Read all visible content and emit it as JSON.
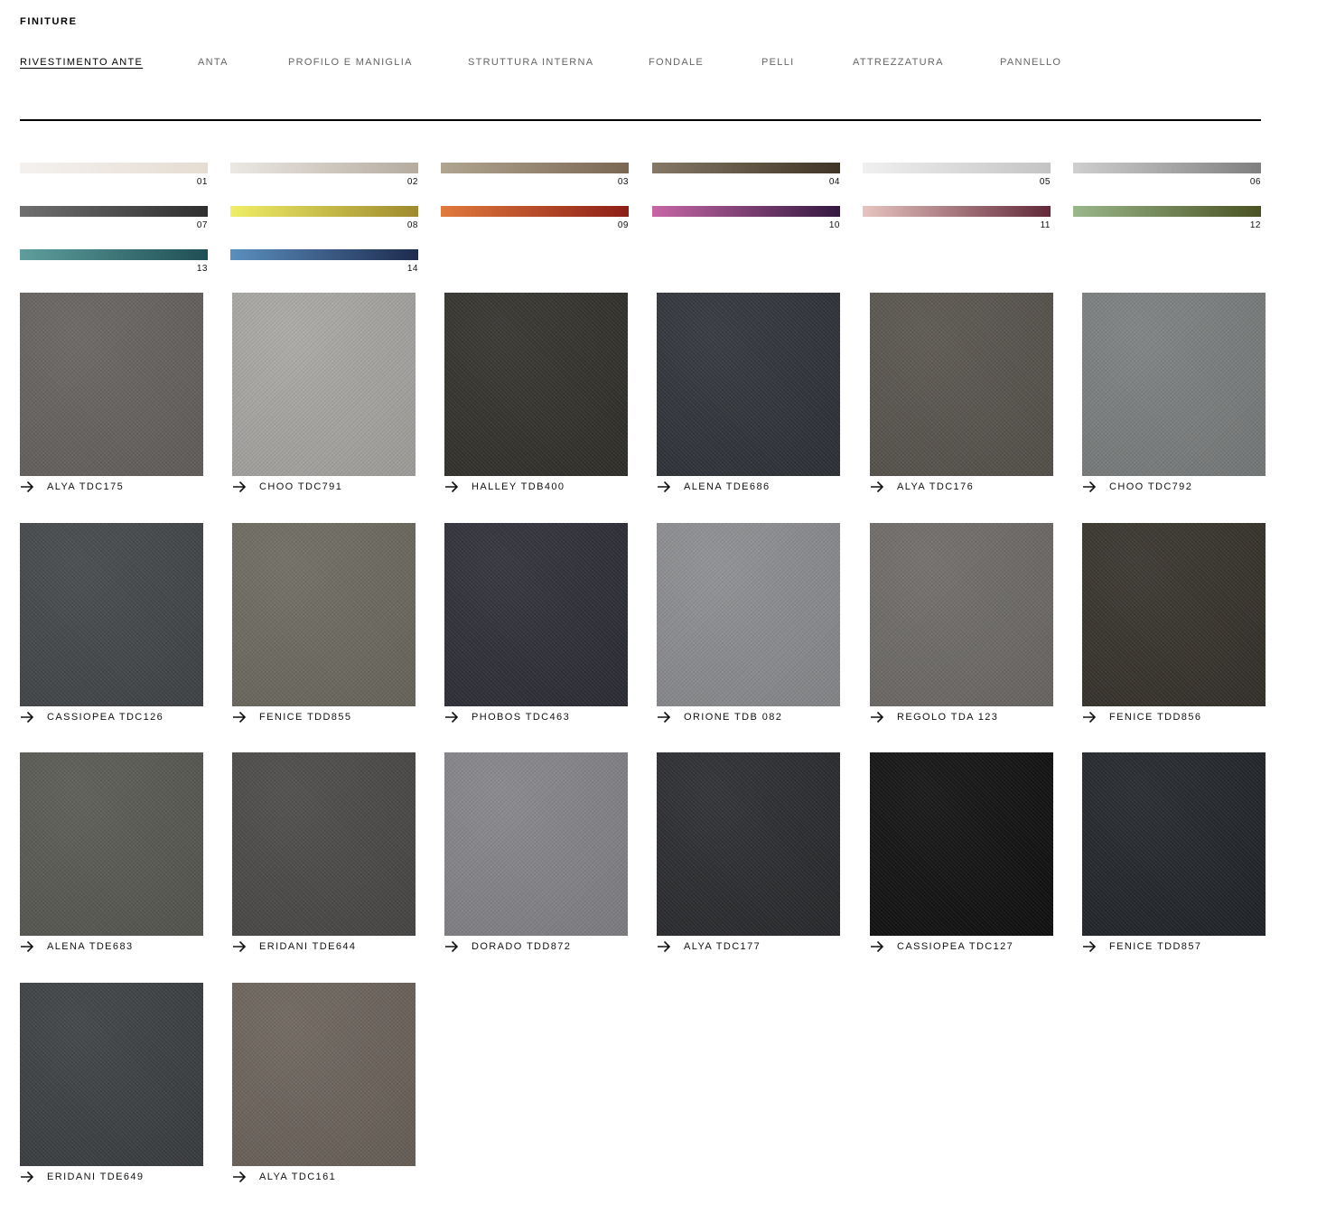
{
  "header": {
    "title": "FINITURE"
  },
  "tabs": [
    {
      "label": "RIVESTIMENTO ANTE",
      "active": true
    },
    {
      "label": "ANTA",
      "active": false
    },
    {
      "label": "PROFILO E MANIGLIA",
      "active": false
    },
    {
      "label": "STRUTTURA INTERNA",
      "active": false
    },
    {
      "label": "FONDALE",
      "active": false
    },
    {
      "label": "PELLI",
      "active": false
    },
    {
      "label": "ATTREZZATURA",
      "active": false
    },
    {
      "label": "PANNELLO",
      "active": false
    }
  ],
  "color_families": [
    {
      "number": "01",
      "from": "#f4f1ef",
      "to": "#e6ddd2"
    },
    {
      "number": "02",
      "from": "#ebe8e3",
      "to": "#b5ab9f"
    },
    {
      "number": "03",
      "from": "#b0a590",
      "to": "#7a6753"
    },
    {
      "number": "04",
      "from": "#857866",
      "to": "#3f3426"
    },
    {
      "number": "05",
      "from": "#f0f0f0",
      "to": "#c4c4c4"
    },
    {
      "number": "06",
      "from": "#cfcfcf",
      "to": "#7f7f7f"
    },
    {
      "number": "07",
      "from": "#707070",
      "to": "#2e2e2e"
    },
    {
      "number": "08",
      "from": "#f0ee66",
      "to": "#9e8a2e"
    },
    {
      "number": "09",
      "from": "#e07a3e",
      "to": "#8c1e16"
    },
    {
      "number": "10",
      "from": "#c667a5",
      "to": "#33183f"
    },
    {
      "number": "11",
      "from": "#e8c4c0",
      "to": "#612838"
    },
    {
      "number": "12",
      "from": "#9ab78a",
      "to": "#4a5222"
    },
    {
      "number": "13",
      "from": "#5f9e9c",
      "to": "#1e4f55"
    },
    {
      "number": "14",
      "from": "#5b8fbe",
      "to": "#1d2b4e"
    }
  ],
  "fabrics": [
    {
      "name": "ALYA TDC175",
      "color": "#676360"
    },
    {
      "name": "CHOO TDC791",
      "color": "#a9a8a5"
    },
    {
      "name": "HALLEY TDB400",
      "color": "#33322d"
    },
    {
      "name": "ALENA TDE686",
      "color": "#30343a"
    },
    {
      "name": "ALYA TDC176",
      "color": "#59554e"
    },
    {
      "name": "CHOO TDC792",
      "color": "#7d8080"
    },
    {
      "name": "CASSIOPEA TDC126",
      "color": "#44474a"
    },
    {
      "name": "FENICE TDD855",
      "color": "#6e6b61"
    },
    {
      "name": "PHOBOS TDC463",
      "color": "#2e2f38"
    },
    {
      "name": "ORIONE TDB 082",
      "color": "#8d8e91"
    },
    {
      "name": "REGOLO TDA 123",
      "color": "#6f6c69"
    },
    {
      "name": "FENICE TDD856",
      "color": "#37332c"
    },
    {
      "name": "ALENA TDE683",
      "color": "#595a54"
    },
    {
      "name": "ERIDANI TDE644",
      "color": "#4c4a48"
    },
    {
      "name": "DORADO TDD872",
      "color": "#86858a"
    },
    {
      "name": "ALYA TDC177",
      "color": "#2b2c2f"
    },
    {
      "name": "CASSIOPEA TDC127",
      "color": "#111111"
    },
    {
      "name": "FENICE TDD857",
      "color": "#22262b"
    },
    {
      "name": "ERIDANI TDE649",
      "color": "#3d4043"
    },
    {
      "name": "ALYA TDC161",
      "color": "#6d645c"
    }
  ]
}
